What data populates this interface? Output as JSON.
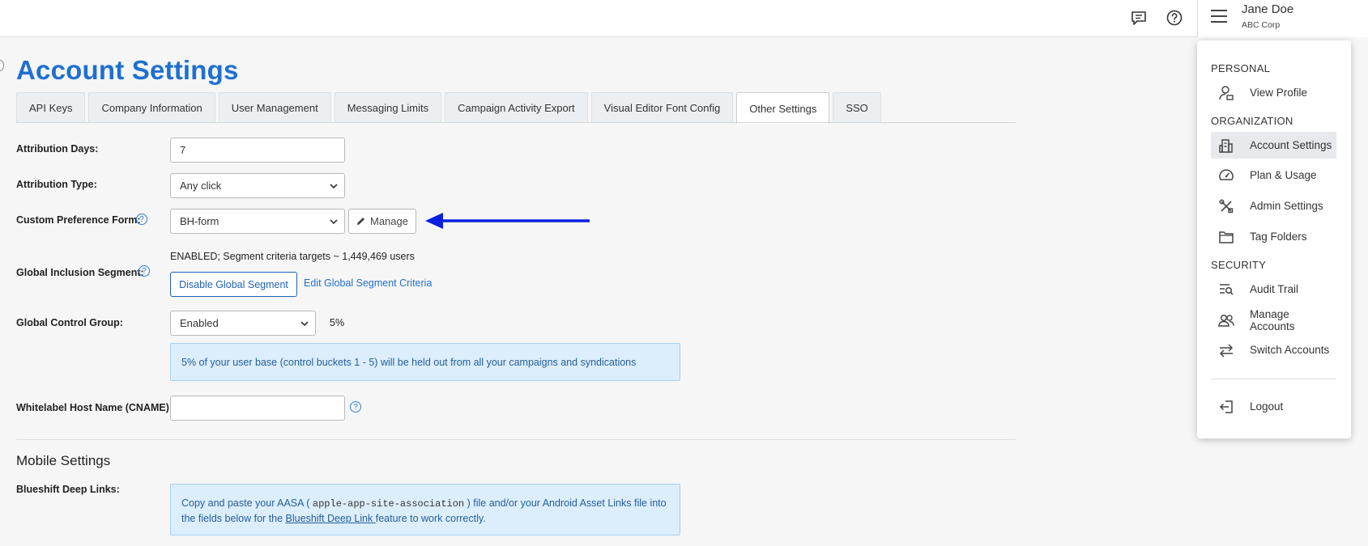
{
  "header": {
    "user_name": "Jane Doe",
    "org_name": "ABC Corp"
  },
  "page": {
    "title": "Account Settings"
  },
  "tabs": [
    {
      "label": "API Keys"
    },
    {
      "label": "Company Information"
    },
    {
      "label": "User Management"
    },
    {
      "label": "Messaging Limits"
    },
    {
      "label": "Campaign Activity Export"
    },
    {
      "label": "Visual Editor Font Config"
    },
    {
      "label": "Other Settings"
    },
    {
      "label": "SSO"
    }
  ],
  "form": {
    "attribution_days_label": "Attribution Days:",
    "attribution_days_value": "7",
    "attribution_type_label": "Attribution Type:",
    "attribution_type_value": "Any click",
    "custom_pref_label": "Custom Preference Form:",
    "custom_pref_value": "BH-form",
    "manage_label": "Manage",
    "global_inclusion_label": "Global Inclusion Segment:",
    "global_inclusion_status": "ENABLED; Segment criteria targets ~ 1,449,469 users",
    "disable_segment_label": "Disable Global Segment",
    "edit_segment_label": "Edit Global Segment Criteria",
    "control_group_label": "Global Control Group:",
    "control_group_value": "Enabled",
    "control_group_percent": "5%",
    "control_group_info": "5% of your user base (control buckets 1 - 5) will be held out from all your campaigns and syndications",
    "cname_label": "Whitelabel Host Name (CNAME):",
    "cname_value": ""
  },
  "mobile": {
    "section_title": "Mobile Settings",
    "deep_links_label": "Blueshift Deep Links:",
    "info_part1": "Copy and paste your AASA ( ",
    "info_code": "apple-app-site-association",
    "info_part2": " ) file and/or your Android Asset Links file into",
    "info_part3": "the fields below for the ",
    "info_link": "Blueshift Deep Link ",
    "info_part4": "feature to work correctly."
  },
  "user_menu": {
    "personal_header": "PERSONAL",
    "view_profile": "View Profile",
    "organization_header": "ORGANIZATION",
    "account_settings": "Account Settings",
    "plan_usage": "Plan & Usage",
    "admin_settings": "Admin Settings",
    "tag_folders": "Tag Folders",
    "security_header": "SECURITY",
    "audit_trail": "Audit Trail",
    "manage_accounts": "Manage Accounts",
    "switch_accounts": "Switch Accounts",
    "logout": "Logout"
  },
  "colors": {
    "accent": "#1f6fd1",
    "arrow": "#0a1fe0",
    "info_bg": "#dceefb"
  }
}
